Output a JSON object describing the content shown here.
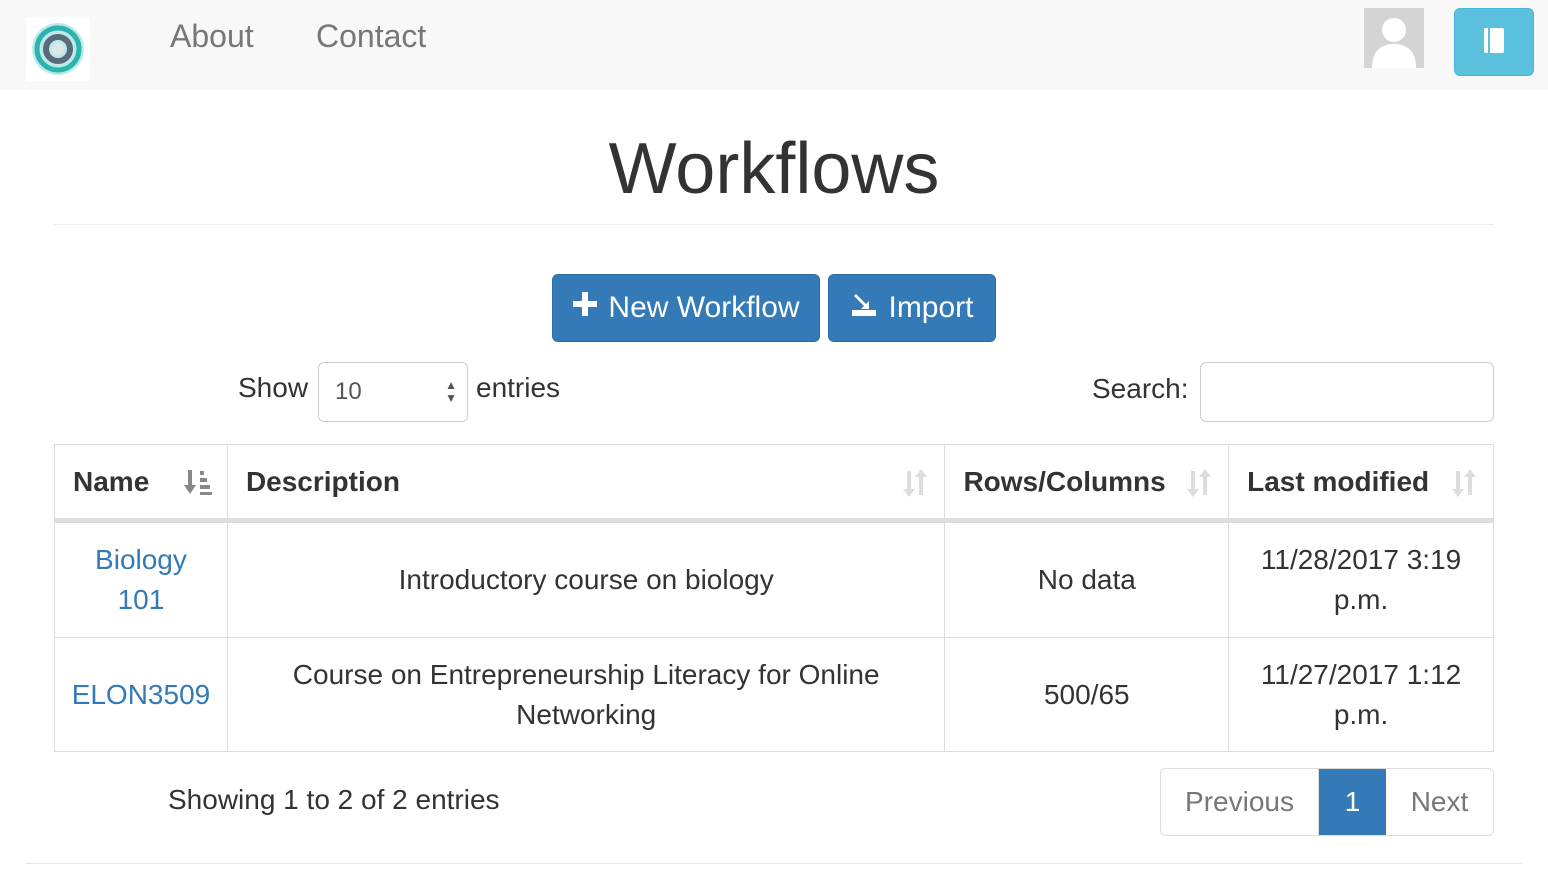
{
  "nav": {
    "about": "About",
    "contact": "Contact"
  },
  "page": {
    "title": "Workflows"
  },
  "actions": {
    "new_workflow": "New Workflow",
    "import": "Import"
  },
  "controls": {
    "show_label": "Show",
    "length_value": "10",
    "entries_label": "entries",
    "search_label": "Search:",
    "search_value": ""
  },
  "table": {
    "headers": [
      "Name",
      "Description",
      "Rows/Columns",
      "Last modified"
    ],
    "sort_state": [
      "ascending",
      "none",
      "none",
      "none"
    ],
    "rows": [
      {
        "name": "Biology 101",
        "description": "Introductory course on biology",
        "rows_columns": "No data",
        "last_modified": "11/28/2017 3:19 p.m."
      },
      {
        "name": "ELON3509",
        "description": "Course on Entrepreneurship Literacy for Online Networking",
        "rows_columns": "500/65",
        "last_modified": "11/27/2017 1:12 p.m."
      }
    ]
  },
  "footer": {
    "info": "Showing 1 to 2 of 2 entries",
    "previous": "Previous",
    "current_page": "1",
    "next": "Next"
  },
  "icons": [
    "logo-icon",
    "user-avatar-icon",
    "book-icon",
    "plus-icon",
    "import-icon",
    "sort-ascending-icon",
    "sort-icon"
  ],
  "colors": {
    "primary": "#337ab7",
    "info": "#5bc0de",
    "navbar_bg": "#f8f8f8",
    "link": "#337ab7"
  }
}
